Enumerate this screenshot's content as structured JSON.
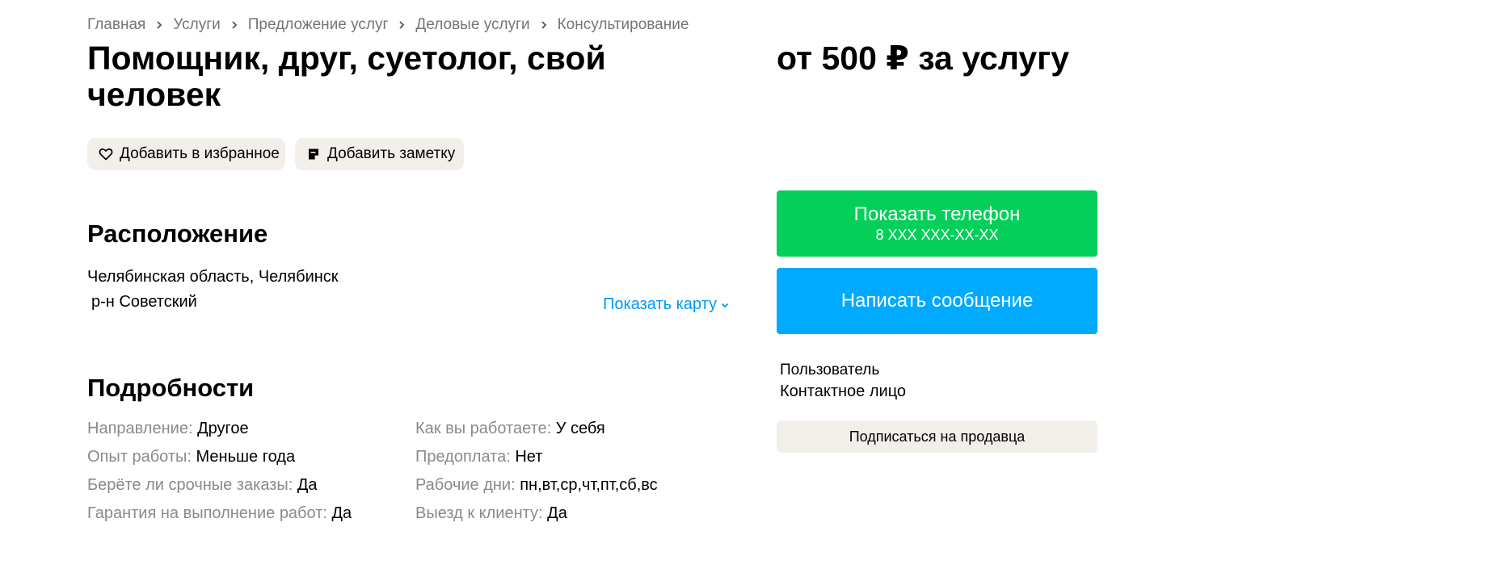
{
  "breadcrumb": [
    "Главная",
    "Услуги",
    "Предложение услуг",
    "Деловые услуги",
    "Консультирование"
  ],
  "title": "Помощник, друг, суетолог, свой человек",
  "price": "от 500 ₽ за услугу",
  "actions": {
    "favorite_label": "Добавить в избранное",
    "note_label": "Добавить заметку"
  },
  "location": {
    "heading": "Расположение",
    "address_line1": "Челябинская область, Челябинск",
    "address_line2": "р-н Советский",
    "show_map_label": "Показать карту"
  },
  "details": {
    "heading": "Подробности",
    "left": [
      {
        "key": "Направление:",
        "value": "Другое"
      },
      {
        "key": "Опыт работы:",
        "value": "Меньше года"
      },
      {
        "key": "Берёте ли срочные заказы:",
        "value": "Да"
      },
      {
        "key": "Гарантия на выполнение работ:",
        "value": "Да"
      }
    ],
    "right": [
      {
        "key": "Как вы работаете:",
        "value": "У себя"
      },
      {
        "key": "Предоплата:",
        "value": "Нет"
      },
      {
        "key": "Рабочие дни:",
        "value": "пн,вт,ср,чт,пт,сб,вс"
      },
      {
        "key": "Выезд к клиенту:",
        "value": "Да"
      }
    ]
  },
  "contact": {
    "show_phone_label": "Показать телефон",
    "phone_masked": "8 XXX XXX-XX-XX",
    "message_label": "Написать сообщение",
    "seller_type": "Пользователь",
    "seller_name": "Контактное лицо",
    "subscribe_label": "Подписаться на продавца"
  },
  "colors": {
    "phone_button": "#04cf59",
    "message_button": "#00aaff",
    "link": "#0099f7",
    "pill_bg": "#f2efeb",
    "muted_text": "#8a8a8a"
  },
  "icons": {
    "favorite": "heart-icon",
    "note": "note-icon",
    "breadcrumb_separator": "chevron-right-icon",
    "show_map": "chevron-down-icon"
  }
}
